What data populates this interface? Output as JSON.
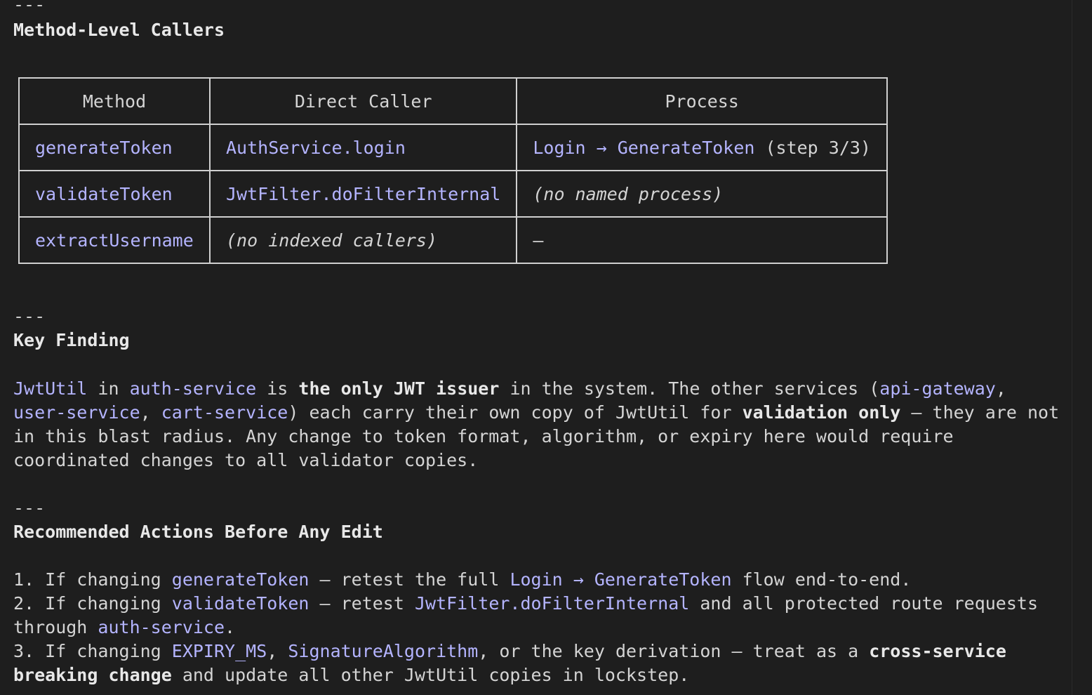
{
  "separator": "---",
  "method_section": {
    "title": "Method-Level Callers",
    "headers": [
      "Method",
      "Direct Caller",
      "Process"
    ],
    "rows": [
      {
        "method": "generateToken",
        "caller": "AuthService.login",
        "process_link": "Login → GenerateToken",
        "process_suffix": " (step 3/3)"
      },
      {
        "method": "validateToken",
        "caller": "JwtFilter.doFilterInternal",
        "process_note": "(no named process)"
      },
      {
        "method": "extractUsername",
        "caller_note": "(no indexed callers)",
        "process_dash": "—"
      }
    ]
  },
  "key_finding": {
    "title": "Key Finding",
    "l1": {
      "a": "JwtUtil",
      "b": " in ",
      "c": "auth-service",
      "d": " is ",
      "e": "the only JWT issuer",
      "f": " in the system. The other services (",
      "g": "api-gateway",
      "h": ","
    },
    "l2": {
      "a": "user-service",
      "b": ", ",
      "c": "cart-service",
      "d": ") each carry their own copy of JwtUtil for ",
      "e": "validation only",
      "f": " — they are not"
    },
    "l3": "in this blast radius. Any change to token format, algorithm, or expiry here would require",
    "l4": "coordinated changes to all validator copies."
  },
  "actions": {
    "title": "Recommended Actions Before Any Edit",
    "a1": {
      "a": "1. If changing ",
      "b": "generateToken",
      "c": " — retest the full ",
      "d": "Login → GenerateToken",
      "e": " flow end-to-end."
    },
    "a2": {
      "a": "2. If changing ",
      "b": "validateToken",
      "c": " — retest ",
      "d": "JwtFilter.doFilterInternal",
      "e": " and all protected route requests"
    },
    "a2b": {
      "a": "through ",
      "b": "auth-service",
      "c": "."
    },
    "a3": {
      "a": "3. If changing ",
      "b": "EXPIRY_MS",
      "c": ", ",
      "d": "SignatureAlgorithm",
      "e": ", or the key derivation — treat as a ",
      "f": "cross-service"
    },
    "a3b": {
      "a": "breaking change",
      "b": " and update all other JwtUtil copies in lockstep."
    }
  }
}
